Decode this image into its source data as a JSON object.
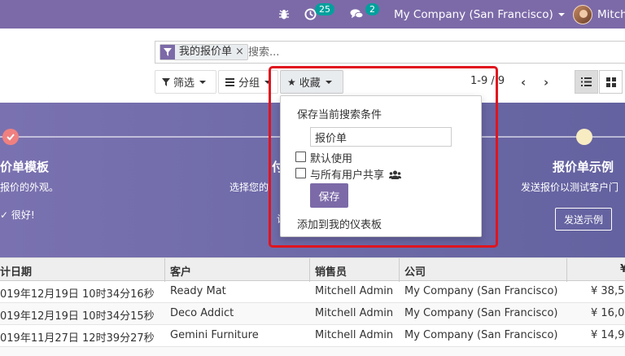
{
  "navbar": {
    "activity_count": "25",
    "message_count": "2",
    "company": "My Company (San Francisco)",
    "user": "Mitch"
  },
  "search": {
    "facet_label": "我的报价单",
    "facet_close": "×",
    "placeholder": "搜索..."
  },
  "toolbar": {
    "filter_label": "筛选",
    "group_label": "分组",
    "favorites_label": "收藏",
    "pager": "1-9 / 9",
    "prev": "‹",
    "next": "›"
  },
  "banner": {
    "step1_title": "价单模板",
    "step1_desc": "报价的外观。",
    "step1_extra": "很好!",
    "step2_title": "付",
    "step2_desc": "选择您的",
    "step2_extra": "设",
    "step3_title": "报价单示例",
    "step3_desc": "发送报价以测试客户门",
    "step3_button": "发送示例",
    "colors": {
      "done": "#f08080",
      "pending": "#f8ecc2"
    }
  },
  "favorites_dropdown": {
    "caption": "保存当前搜索条件",
    "name_value": "报价单",
    "default_label": "默认使用",
    "share_label": "与所有用户共享",
    "save_label": "保存",
    "dashboard_label": "添加到我的仪表板"
  },
  "table": {
    "headers": [
      "计日期",
      "客户",
      "销售员",
      "公司",
      "¥"
    ],
    "rows": [
      {
        "date": "019年12月19日 10时34分16秒",
        "customer": "Ready Mat",
        "salesperson": "Mitchell Admin",
        "company": "My Company (San Francisco)",
        "amount": "¥ 38,5"
      },
      {
        "date": "019年12月19日 10时34分15秒",
        "customer": "Deco Addict",
        "salesperson": "Mitchell Admin",
        "company": "My Company (San Francisco)",
        "amount": "¥ 16,0"
      },
      {
        "date": "019年11月27日 12时39分27秒",
        "customer": "Gemini Furniture",
        "salesperson": "Mitchell Admin",
        "company": "My Company (San Francisco)",
        "amount": "¥ 14,9"
      }
    ]
  }
}
